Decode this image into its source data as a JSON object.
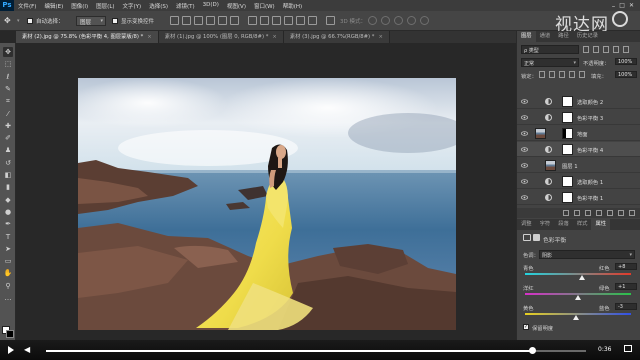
{
  "menubar": {
    "logo": "Ps",
    "items": [
      "文件(F)",
      "编辑(E)",
      "图像(I)",
      "图层(L)",
      "文字(Y)",
      "选择(S)",
      "滤镜(T)",
      "3D(D)",
      "视图(V)",
      "窗口(W)",
      "帮助(H)"
    ]
  },
  "options": {
    "auto_select_label": "自动选择：",
    "auto_select_value": "图层",
    "show_transform_label": "显示变换控件",
    "mode_3d_label": "3D 模式："
  },
  "watermark": "视达网",
  "doc_tabs": [
    {
      "label": "素材 (2).jpg @ 75.8% (色彩平衡 4, 图层蒙版/8) *",
      "active": true
    },
    {
      "label": "素材 (1).jpg @ 100% (图层 0, RGB/8#) *",
      "active": false
    },
    {
      "label": "素材 (3).jpg @ 66.7%(RGB/8#) *",
      "active": false
    }
  ],
  "layers_panel": {
    "tabs": [
      "图层",
      "通道",
      "路径",
      "历史记录"
    ],
    "kind_label": "ρ 类型",
    "blend_mode": "正常",
    "opacity_label": "不透明度：",
    "opacity_value": "100%",
    "lock_label": "锁定：",
    "fill_label": "填充：",
    "fill_value": "100%",
    "layers": [
      {
        "name": "选取颜色 2",
        "selected": false
      },
      {
        "name": "色彩平衡 3",
        "selected": false
      },
      {
        "name": "地面",
        "selected": false
      },
      {
        "name": "色彩平衡 4",
        "selected": true
      },
      {
        "name": "图层 1",
        "selected": false
      },
      {
        "name": "选取颜色 1",
        "selected": false
      },
      {
        "name": "色彩平衡 1",
        "selected": false
      }
    ]
  },
  "properties_panel": {
    "tabs": [
      "调整",
      "字符",
      "段落",
      "样式",
      "属性"
    ],
    "title": "色彩平衡",
    "tone_label": "色调：",
    "tone_value": "阴影",
    "sliders": [
      {
        "left": "青色",
        "right": "红色",
        "value": "+8",
        "position": 0.54,
        "gradient": [
          "#22d4e0",
          "#e23a2a"
        ]
      },
      {
        "left": "洋红",
        "right": "绿色",
        "value": "+1",
        "position": 0.5,
        "gradient": [
          "#d630c8",
          "#2ac24a"
        ]
      },
      {
        "left": "黄色",
        "right": "蓝色",
        "value": "-3",
        "position": 0.48,
        "gradient": [
          "#e8d020",
          "#3050e8"
        ]
      }
    ],
    "preserve_luminosity_label": "保留明度",
    "preserve_luminosity_checked": true
  },
  "player": {
    "time": "0:36",
    "progress": 0.9
  },
  "colors": {
    "accent": "#31a8ff",
    "chrome_dark": "#282828",
    "panel": "#434343"
  }
}
